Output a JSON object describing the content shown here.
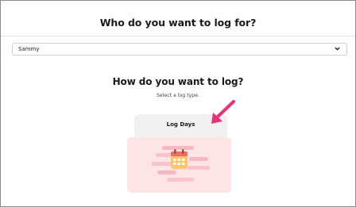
{
  "header": {
    "title": "Who do you want to log for?"
  },
  "person_select": {
    "selected": "Sammy",
    "icon": "chevron-down-icon"
  },
  "log_section": {
    "title": "How do you want to log?",
    "subtitle": "Select a log type."
  },
  "log_type_card": {
    "label": "Log Days",
    "icon": "calendar-icon",
    "colors": {
      "card_background": "#fde4e6",
      "calendar_accent": "#f26b6b",
      "calendar_face": "#ffc567"
    }
  },
  "annotation": {
    "icon": "pointer-arrow-icon",
    "color": "#e9307a"
  }
}
